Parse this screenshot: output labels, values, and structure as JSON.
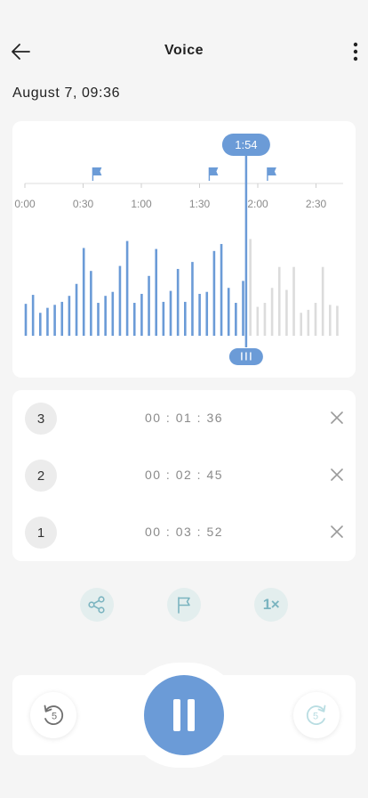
{
  "header": {
    "title": "Voice",
    "back_icon": "arrow-left-icon",
    "menu_icon": "more-vertical-icon"
  },
  "recording": {
    "date": "August 7, 09:36"
  },
  "waveform": {
    "duration_seconds": 165,
    "tick_labels": [
      "0:00",
      "0:30",
      "1:00",
      "1:30",
      "2:00",
      "2:30"
    ],
    "playhead_label": "1:54",
    "playhead_seconds": 114,
    "flag_seconds": [
      35,
      95,
      125
    ],
    "played_color": "#6b9bd7",
    "unplayed_color": "#dcdcdc",
    "levels": [
      0.32,
      0.41,
      0.23,
      0.28,
      0.31,
      0.34,
      0.4,
      0.52,
      0.88,
      0.65,
      0.33,
      0.4,
      0.44,
      0.7,
      0.95,
      0.33,
      0.42,
      0.6,
      0.87,
      0.34,
      0.45,
      0.67,
      0.34,
      0.74,
      0.42,
      0.44,
      0.85,
      0.92,
      0.48,
      0.33,
      0.55,
      0.97,
      0.29,
      0.33,
      0.48,
      0.69,
      0.46,
      0.69,
      0.23,
      0.26,
      0.33,
      0.69,
      0.31,
      0.3
    ]
  },
  "marks": [
    {
      "index": "3",
      "time": "00 : 01 : 36"
    },
    {
      "index": "2",
      "time": "00 : 02 : 45"
    },
    {
      "index": "1",
      "time": "00 : 03 : 52"
    }
  ],
  "actions": {
    "speed_label": "1×"
  },
  "player": {
    "skip_back_label": "5",
    "skip_forward_label": "5",
    "accent": "#6b9bd7"
  }
}
